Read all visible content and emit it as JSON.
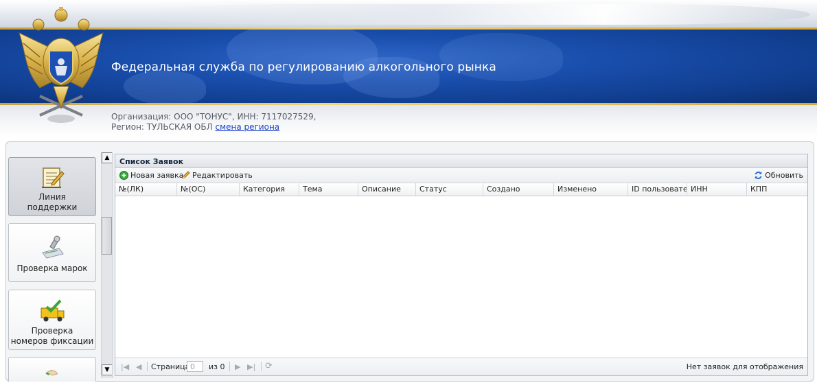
{
  "header": {
    "service_title": "Федеральная служба по регулированию алкогольного рынка",
    "org_line": "Организация: ООО \"ТОНУС\", ИНН: 7117027529,",
    "region_prefix": "Регион: ТУЛЬСКАЯ ОБЛ",
    "change_region_link": "смена региона"
  },
  "sidebar": {
    "items": [
      {
        "label_line1": "Линия",
        "label_line2": "поддержки",
        "icon": "notepad-icon",
        "active": true
      },
      {
        "label_line1": "Проверка марок",
        "label_line2": "",
        "icon": "stamp-check-icon",
        "active": false
      },
      {
        "label_line1": "Проверка",
        "label_line2": "номеров фиксации",
        "icon": "truck-check-icon",
        "active": false
      },
      {
        "label_line1": "",
        "label_line2": "",
        "icon": "handshake-icon",
        "active": false
      }
    ]
  },
  "grid": {
    "title": "Список Заявок",
    "toolbar": {
      "new_request": "Новая заявка",
      "edit": "Редактировать",
      "refresh": "Обновить"
    },
    "columns": [
      "№(ЛК)",
      "№(ОС)",
      "Категория",
      "Тема",
      "Описание",
      "Статус",
      "Создано",
      "Изменено",
      "ID пользователя",
      "ИНН",
      "КПП"
    ],
    "rows": [],
    "paging": {
      "page_label": "Страница",
      "page_value": "0",
      "of_label": "из 0",
      "empty_message": "Нет заявок для отображения"
    }
  },
  "colors": {
    "header_blue": "#1a4fae",
    "gold": "#d4a838",
    "link": "#1a3fc8",
    "add_green": "#3aa63a"
  }
}
